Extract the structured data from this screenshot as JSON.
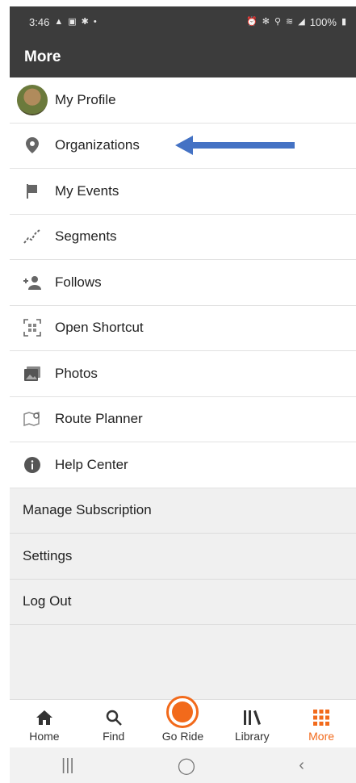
{
  "status_bar": {
    "time": "3:46",
    "left_icons": [
      "navigation-icon",
      "image-icon",
      "star-icon",
      "dot-icon"
    ],
    "right_icons": [
      "alarm-icon",
      "bluetooth-icon",
      "location-icon",
      "wifi-icon",
      "signal-icon"
    ],
    "battery": "100%"
  },
  "app_bar": {
    "title": "More"
  },
  "menu": {
    "items": [
      {
        "label": "My Profile",
        "icon": "avatar"
      },
      {
        "label": "Organizations",
        "icon": "location-pin-icon"
      },
      {
        "label": "My Events",
        "icon": "flag-icon"
      },
      {
        "label": "Segments",
        "icon": "segment-line-icon"
      },
      {
        "label": "Follows",
        "icon": "add-person-icon"
      },
      {
        "label": "Open Shortcut",
        "icon": "qr-scan-icon"
      },
      {
        "label": "Photos",
        "icon": "photos-icon"
      },
      {
        "label": "Route Planner",
        "icon": "map-pin-icon"
      },
      {
        "label": "Help Center",
        "icon": "info-icon"
      }
    ],
    "secondary": [
      {
        "label": "Manage Subscription"
      },
      {
        "label": "Settings"
      },
      {
        "label": "Log Out"
      }
    ]
  },
  "annotation": {
    "arrow_color": "#4472c4",
    "points_to": "Organizations"
  },
  "tab_bar": {
    "tabs": [
      {
        "label": "Home",
        "icon": "home-icon"
      },
      {
        "label": "Find",
        "icon": "search-icon"
      },
      {
        "label": "Go Ride",
        "icon": "record-icon"
      },
      {
        "label": "Library",
        "icon": "library-icon"
      },
      {
        "label": "More",
        "icon": "grid-icon",
        "active": true
      }
    ],
    "accent_color": "#f26a1b"
  },
  "system_nav": {
    "icons": [
      "recents-icon",
      "home-circle-icon",
      "back-icon"
    ]
  }
}
